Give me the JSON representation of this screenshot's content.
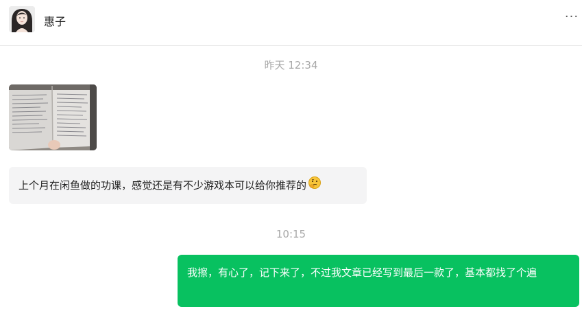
{
  "chat": {
    "contact_name": "惠子",
    "more_label": "···"
  },
  "messages": {
    "timestamp_1": "昨天 12:34",
    "incoming_text": "上个月在闲鱼做的功课，感觉还是有不少游戏本可以给你推荐的",
    "incoming_emoji": "thinking-emoji",
    "timestamp_2": "10:15",
    "outgoing_text": "我擦，有心了，记下来了，不过我文章已经写到最后一款了，基本都找了个遍"
  },
  "colors": {
    "outgoing_bubble": "#08c160",
    "incoming_bubble": "#f4f4f5",
    "timestamp": "#a8a8a8"
  }
}
